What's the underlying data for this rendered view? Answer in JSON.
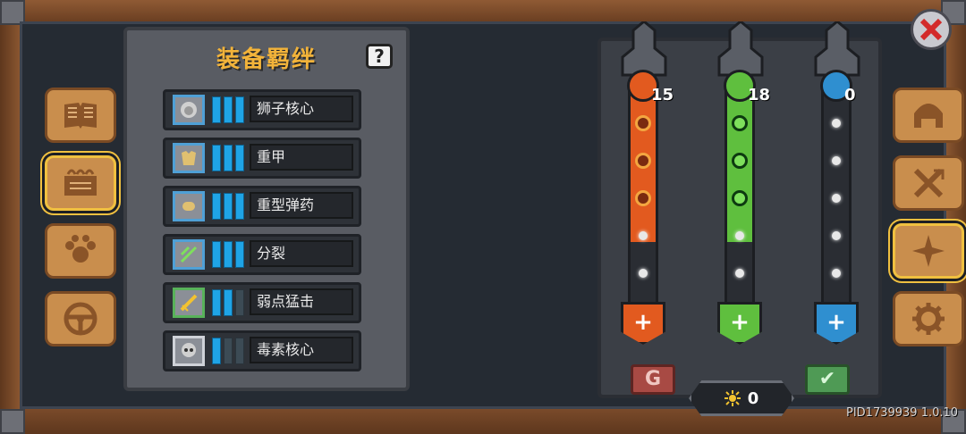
{
  "bond_panel": {
    "title": "装备羁绊",
    "help": "?",
    "rows": [
      {
        "name": "狮子核心",
        "level": 3,
        "max": 3,
        "icon": "lion-head-icon",
        "frame": "blue"
      },
      {
        "name": "重甲",
        "level": 3,
        "max": 3,
        "icon": "armor-icon",
        "frame": "blue"
      },
      {
        "name": "重型弹药",
        "level": 3,
        "max": 3,
        "icon": "ammo-icon",
        "frame": "blue"
      },
      {
        "name": "分裂",
        "level": 3,
        "max": 3,
        "icon": "split-arrows-icon",
        "frame": "blue"
      },
      {
        "name": "弱点猛击",
        "level": 2,
        "max": 3,
        "icon": "weak-strike-icon",
        "frame": "green"
      },
      {
        "name": "毒素核心",
        "level": 1,
        "max": 3,
        "icon": "skull-icon",
        "frame": "gray"
      }
    ]
  },
  "left_tabs": [
    {
      "name": "book-tab",
      "icon": "book-icon",
      "active": false
    },
    {
      "name": "scroll-tab",
      "icon": "scroll-icon",
      "active": true
    },
    {
      "name": "paw-tab",
      "icon": "paw-icon",
      "active": false
    },
    {
      "name": "steering-tab",
      "icon": "steering-wheel-icon",
      "active": false
    }
  ],
  "right_tabs": [
    {
      "name": "helmet-tab",
      "icon": "helmet-icon",
      "active": false
    },
    {
      "name": "swords-tab",
      "icon": "crossed-swords-icon",
      "active": false
    },
    {
      "name": "compass-tab",
      "icon": "compass-star-icon",
      "active": true
    },
    {
      "name": "gear-tab",
      "icon": "gear-icon",
      "active": false
    }
  ],
  "talents": [
    {
      "class": "knight",
      "count": "15",
      "color": "#e25a1f",
      "filled": 3,
      "slots": 5
    },
    {
      "class": "ranger",
      "count": "18",
      "color": "#5fbf3e",
      "filled": 3,
      "slots": 5
    },
    {
      "class": "mage",
      "count": "0",
      "color": "#2f8fd0",
      "filled": 0,
      "slots": 5
    }
  ],
  "buttons": {
    "reset": "G",
    "confirm": "✔",
    "plus": "+"
  },
  "points": "0",
  "version": "PID1739939 1.0.10"
}
